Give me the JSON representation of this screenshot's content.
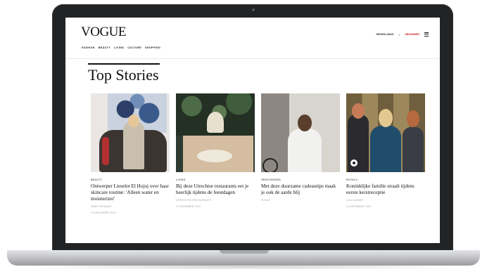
{
  "site": {
    "logo": "VOGUE",
    "nav": [
      "FASHION",
      "BEAUTY",
      "LIVING",
      "CULTURE",
      "SHOPPING"
    ],
    "language": "NEDERLANDS",
    "cta": "ABONNEER",
    "menu_icon": "hamburger-icon"
  },
  "section": {
    "title": "Top Stories"
  },
  "cards": [
    {
      "category": "BEAUTY",
      "title": "Ontwerper Lieselot El Hojoj over haar skincare routine: 'Alleen water en moisturizer'",
      "meta": "ANNE HERMANS",
      "date": "12 DECEMBER 2023"
    },
    {
      "category": "LIVING",
      "title": "Bij deze Utrechtse restaurants eet je heerlijk tijdens de feestdagen",
      "meta": "UTRECHTSE RESTAURANTS",
      "date": "11 DECEMBER 2023"
    },
    {
      "category": "GESPONSORD",
      "title": "Met deze duurzame cadeautips maak je ook de aarde blij",
      "meta": "VOGUE",
      "date": ""
    },
    {
      "category": "ROYALS",
      "title": "Koninklijke familie straalt tijdens eerste kerstreceptie",
      "meta": "LISA LANGER",
      "date": "14 DECEMBER 2023"
    }
  ]
}
